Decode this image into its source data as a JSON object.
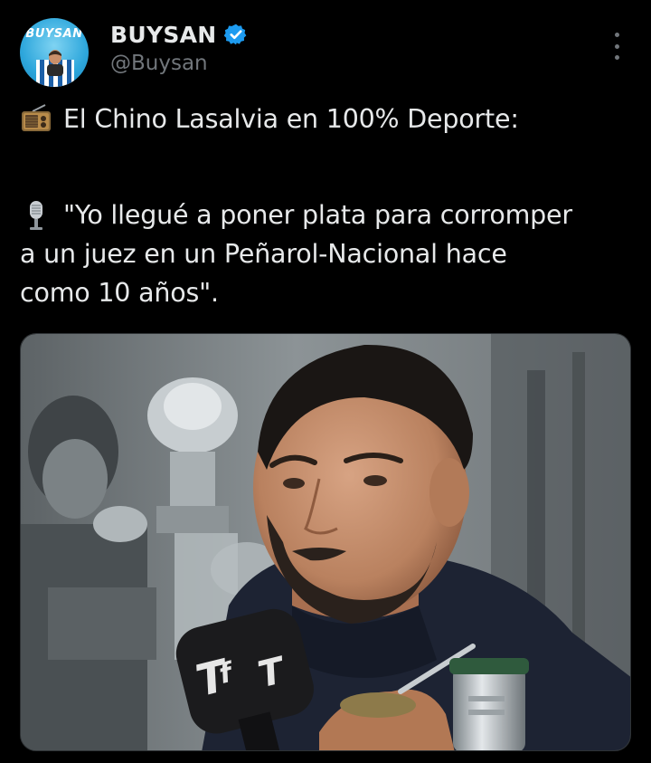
{
  "author": {
    "display_name": "BUYSAN",
    "handle": "@Buysan",
    "verified": true,
    "avatar": {
      "logo_text": "BUYSAN",
      "background_color": "#2ea7dc"
    }
  },
  "post": {
    "lines": [
      {
        "emoji": "radio-icon",
        "text": "El Chino Lasalvia en 100% Deporte:"
      },
      {
        "emoji": null,
        "text": ""
      },
      {
        "emoji": "microphone-icon",
        "text": "\"Yo llegué a poner plata para corromper"
      },
      {
        "emoji": null,
        "text": "a un juez en un Peñarol-Nacional hace"
      },
      {
        "emoji": null,
        "text": "como 10 años\"."
      }
    ]
  },
  "media": {
    "type": "photo",
    "description_icon": "interview-photo"
  },
  "theme": {
    "background": "#000000",
    "text_primary": "#e7e9ea",
    "text_secondary": "#71767b",
    "verified_color": "#1d9bf0"
  }
}
